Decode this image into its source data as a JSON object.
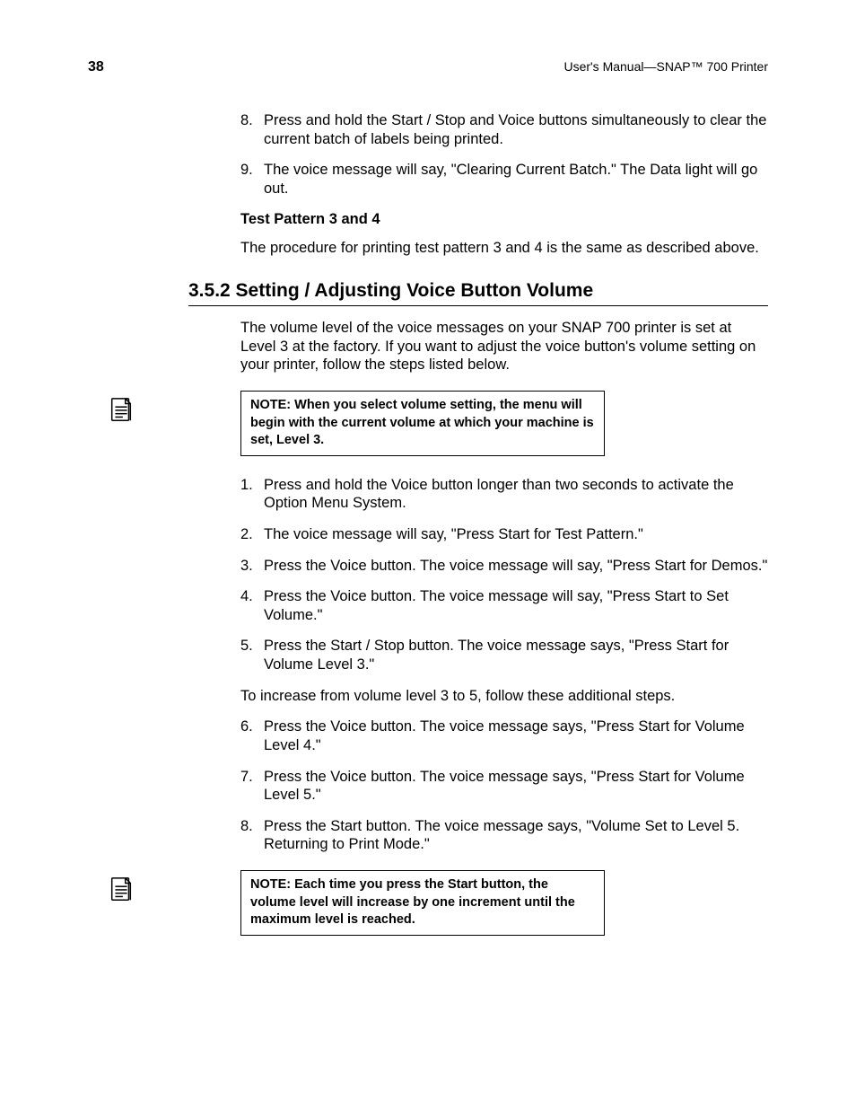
{
  "header": {
    "page_number": "38",
    "doc_title": "User's Manual—SNAP™ 700 Printer"
  },
  "top_list": {
    "item8_num": "8.",
    "item8_txt": "Press and hold the Start / Stop and Voice buttons simultaneously to clear the current batch of labels being printed.",
    "item9_num": "9.",
    "item9_txt": "The voice message will say, \"Clearing Current Batch.\"  The Data light will go out."
  },
  "test_pattern": {
    "heading": "Test Pattern 3 and 4",
    "para": "The procedure for printing test pattern 3 and 4 is the same as described above."
  },
  "section": {
    "title": "3.5.2 Setting / Adjusting Voice Button Volume",
    "intro": "The volume level of the voice messages on your SNAP 700 printer is set at Level 3 at the factory.  If you want to adjust the voice button's volume setting on your printer, follow the steps listed below."
  },
  "note1": "NOTE: When you select volume setting, the menu will begin with the current volume at which your machine is set, Level 3.",
  "steps": {
    "s1n": "1.",
    "s1t": "Press and hold the Voice button longer than two seconds to activate the Option Menu System.",
    "s2n": "2.",
    "s2t": "The voice message will say, \"Press Start for Test Pattern.\"",
    "s3n": "3.",
    "s3t": "Press the Voice button.  The voice message will say, \"Press Start for Demos.\"",
    "s4n": "4.",
    "s4t": "Press the Voice button.  The voice message will say, \"Press Start to Set Volume.\"",
    "s5n": "5.",
    "s5t": "Press the Start / Stop button.  The voice message says, \"Press Start for Volume Level 3.\""
  },
  "mid_para": "To increase from volume level 3 to 5, follow these additional steps.",
  "steps2": {
    "s6n": "6.",
    "s6t": "Press the Voice button.  The voice message says, \"Press Start for Volume Level 4.\"",
    "s7n": "7.",
    "s7t": "Press the Voice button.  The voice message says, \"Press Start for Volume Level 5.\"",
    "s8n": "8.",
    "s8t": "Press the Start button.  The voice message says, \"Volume Set to Level 5.  Returning to Print Mode.\""
  },
  "note2": "NOTE: Each time you press the Start button, the volume level will increase by one increment until the maximum level is reached."
}
